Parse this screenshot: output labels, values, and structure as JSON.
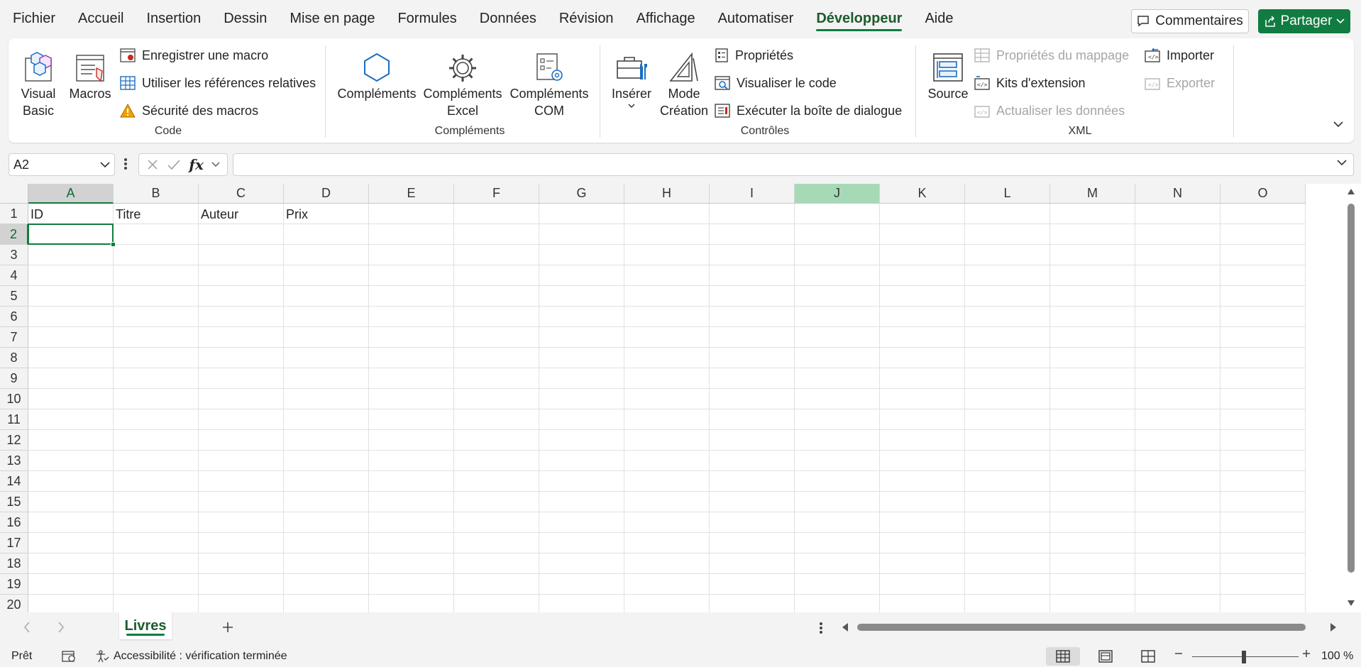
{
  "menu": {
    "tabs": [
      "Fichier",
      "Accueil",
      "Insertion",
      "Dessin",
      "Mise en page",
      "Formules",
      "Données",
      "Révision",
      "Affichage",
      "Automatiser",
      "Développeur",
      "Aide"
    ],
    "active_tab": "Développeur",
    "comments_label": "Commentaires",
    "share_label": "Partager"
  },
  "ribbon": {
    "code": {
      "visual_basic_1": "Visual",
      "visual_basic_2": "Basic",
      "macros": "Macros",
      "record_macro": "Enregistrer une macro",
      "relative_refs": "Utiliser les références relatives",
      "macro_security": "Sécurité des macros",
      "label": "Code"
    },
    "addins": {
      "complements": "Compléments",
      "excel_1": "Compléments",
      "excel_2": "Excel",
      "com_1": "Compléments",
      "com_2": "COM",
      "label": "Compléments"
    },
    "controls": {
      "insert": "Insérer",
      "design_1": "Mode",
      "design_2": "Création",
      "properties": "Propriétés",
      "view_code": "Visualiser le code",
      "run_dialog": "Exécuter la boîte de dialogue",
      "label": "Contrôles"
    },
    "xml": {
      "source": "Source",
      "map_properties": "Propriétés du mappage",
      "expansion_packs": "Kits d'extension",
      "refresh_data": "Actualiser les données",
      "import": "Importer",
      "export": "Exporter",
      "label": "XML"
    }
  },
  "formula_bar": {
    "name_box": "A2",
    "fx": "fx",
    "formula": ""
  },
  "grid": {
    "columns": [
      "A",
      "B",
      "C",
      "D",
      "E",
      "F",
      "G",
      "H",
      "I",
      "J",
      "K",
      "L",
      "M",
      "N",
      "O"
    ],
    "selected_column": "A",
    "highlighted_column": "J",
    "rows": [
      "1",
      "2",
      "3",
      "4",
      "5",
      "6",
      "7",
      "8",
      "9",
      "10",
      "11",
      "12",
      "13",
      "14",
      "15",
      "16",
      "17",
      "18",
      "19",
      "20"
    ],
    "selected_row": "2",
    "headers": {
      "A1": "ID",
      "B1": "Titre",
      "C1": "Auteur",
      "D1": "Prix"
    },
    "active_cell": "A2"
  },
  "sheets": {
    "tabs": [
      "Livres"
    ],
    "active": "Livres"
  },
  "status": {
    "ready": "Prêt",
    "accessibility": "Accessibilité : vérification terminée",
    "zoom": "100 %"
  },
  "colors": {
    "accent": "#107c41",
    "highlight_column": "#a6dab7",
    "warning": "#f2a100",
    "icon_blue": "#1b6ec2"
  },
  "icons": [
    "comment-icon",
    "share-icon",
    "visual-basic-icon",
    "macros-icon",
    "record-macro-icon",
    "relative-refs-icon",
    "warning-icon",
    "complements-icon",
    "gear-icon",
    "com-addins-icon",
    "toolbox-icon",
    "design-mode-icon",
    "properties-icon",
    "view-code-icon",
    "run-dialog-icon",
    "source-icon",
    "map-properties-icon",
    "expansion-packs-icon",
    "refresh-data-icon",
    "import-icon",
    "export-icon",
    "chevron-down-icon",
    "close-icon",
    "check-icon",
    "plus-icon",
    "accessibility-icon",
    "normal-view-icon",
    "page-layout-icon",
    "page-break-icon"
  ]
}
